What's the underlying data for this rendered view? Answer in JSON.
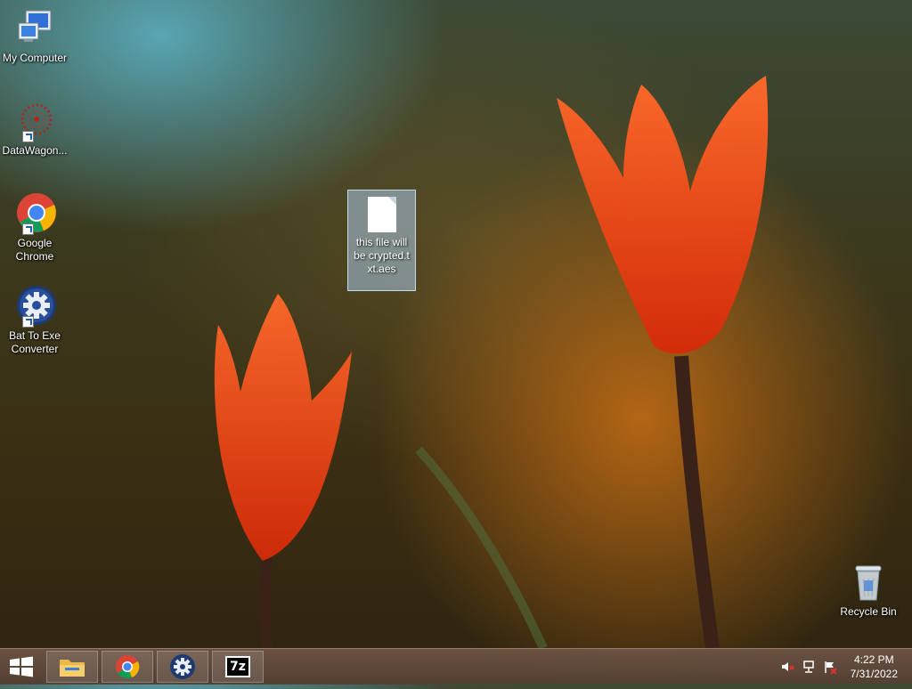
{
  "desktop": {
    "icons": [
      {
        "id": "my-computer",
        "label": "My Computer"
      },
      {
        "id": "datawagon",
        "label": "DataWagon..."
      },
      {
        "id": "google-chrome",
        "label": "Google Chrome"
      },
      {
        "id": "bat-to-exe",
        "label": "Bat To Exe Converter"
      }
    ],
    "selected_file": {
      "label": "this file will be crypted.txt.aes"
    },
    "recycle_bin": {
      "label": "Recycle Bin"
    }
  },
  "taskbar": {
    "pinned": [
      {
        "id": "file-explorer",
        "icon": "folder-icon"
      },
      {
        "id": "chrome",
        "icon": "chrome-icon"
      },
      {
        "id": "bat-to-exe",
        "icon": "gear-icon"
      },
      {
        "id": "7zip",
        "icon": "7zip-icon",
        "text": "7z"
      }
    ],
    "tray": {
      "icons": [
        "volume-muted-icon",
        "network-icon",
        "action-center-flag-icon"
      ],
      "time": "4:22 PM",
      "date": "7/31/2022"
    }
  },
  "colors": {
    "tulip": "#ff4a1a",
    "taskbar": "#6b5244",
    "selection": "#aac8e6",
    "chrome_red": "#db4437",
    "chrome_yellow": "#f4b400",
    "chrome_green": "#0f9d58",
    "chrome_blue": "#4285f4"
  }
}
